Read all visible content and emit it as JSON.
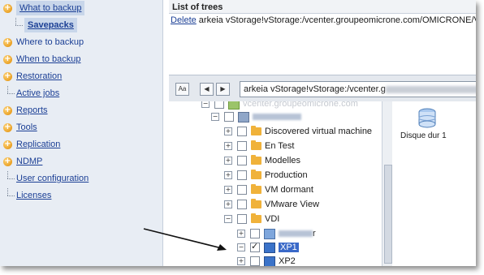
{
  "sidebar": {
    "items": [
      {
        "label": "What to backup",
        "type": "bullet",
        "selected": true
      },
      {
        "label": "Savepacks",
        "type": "sub",
        "selected": true
      },
      {
        "label": "Where to backup",
        "type": "bullet"
      },
      {
        "label": "When to backup",
        "type": "bullet"
      },
      {
        "label": "Restoration",
        "type": "bullet"
      },
      {
        "label": "Active jobs",
        "type": "line"
      },
      {
        "label": "Reports",
        "type": "bullet"
      },
      {
        "label": "Tools",
        "type": "bullet"
      },
      {
        "label": "Replication",
        "type": "bullet"
      },
      {
        "label": "NDMP",
        "type": "bullet"
      },
      {
        "label": "User configuration",
        "type": "line"
      },
      {
        "label": "Licenses",
        "type": "line"
      }
    ]
  },
  "list": {
    "title": "List of trees",
    "delete_label": "Delete",
    "entry": "arkeia vStorage!vStorage:/vcenter.groupeomicrone.com/OMICRONE/VD"
  },
  "toolbar": {
    "aa_label": "Aa",
    "back_label": "◀",
    "forward_label": "▶",
    "path_prefix": "arkeia vStorage!vStorage:/vcenter.g",
    "path_suffix": "OM"
  },
  "tree": {
    "root_label": "vcenter.groupeomicrone.com",
    "nodes": [
      {
        "label": "Discovered virtual machine"
      },
      {
        "label": "En Test"
      },
      {
        "label": "Modelles"
      },
      {
        "label": "Production"
      },
      {
        "label": "VM dormant"
      },
      {
        "label": "VMware View"
      },
      {
        "label": "VDI"
      }
    ],
    "child_suffix": "r",
    "selected_vm": "XP1",
    "next_vm": "XP2"
  },
  "details": {
    "disk_label": "Disque dur 1"
  },
  "colors": {
    "accent": "#1b3f95",
    "folder": "#f0b23a",
    "selection": "#3a69c8"
  }
}
